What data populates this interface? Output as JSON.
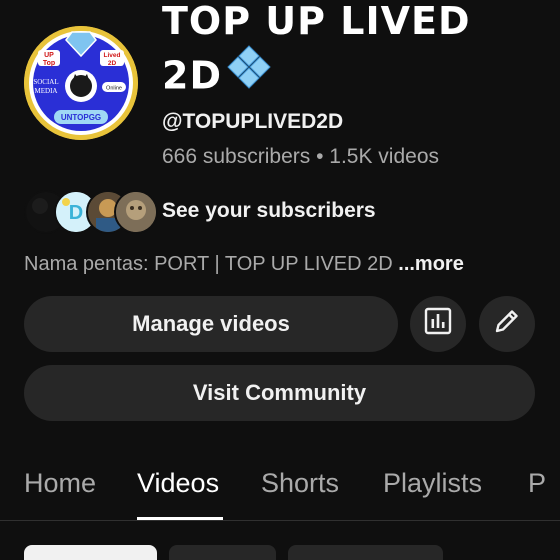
{
  "channel": {
    "title_line1": "TOP UP LIVED",
    "title_line2": "2D",
    "title_icon": "blue-diamond-gem-icon",
    "handle": "@TOPUPLIVED2D",
    "stats": "666 subscribers • 1.5K videos",
    "avatar_texts": {
      "top_left": "UP\nTop",
      "top_right": "Lived\n2D",
      "left": "SOCIAL\nMEDIA",
      "right": "Online",
      "bottom": "UNTOPGG"
    }
  },
  "subscribers": {
    "label": "See your subscribers",
    "avatar_count": 4
  },
  "description": {
    "text": "Nama pentas: PORT | TOP UP LIVED 2D ",
    "more": "...more"
  },
  "buttons": {
    "manage_videos": "Manage videos",
    "analytics_icon": "analytics-bar-chart-icon",
    "edit_icon": "pencil-edit-icon",
    "visit_community": "Visit Community"
  },
  "tabs": [
    {
      "label": "Home",
      "active": false
    },
    {
      "label": "Videos",
      "active": true
    },
    {
      "label": "Shorts",
      "active": false
    },
    {
      "label": "Playlists",
      "active": false
    },
    {
      "label": "P",
      "active": false
    }
  ],
  "colors": {
    "background": "#0f0f0f",
    "button_bg": "#272727",
    "primary_text": "#f1f1f1",
    "secondary_text": "#aaaaaa",
    "avatar_ring": "#e8c33a",
    "avatar_inner": "#2a2fd6",
    "gem": "#7fc4f0"
  }
}
